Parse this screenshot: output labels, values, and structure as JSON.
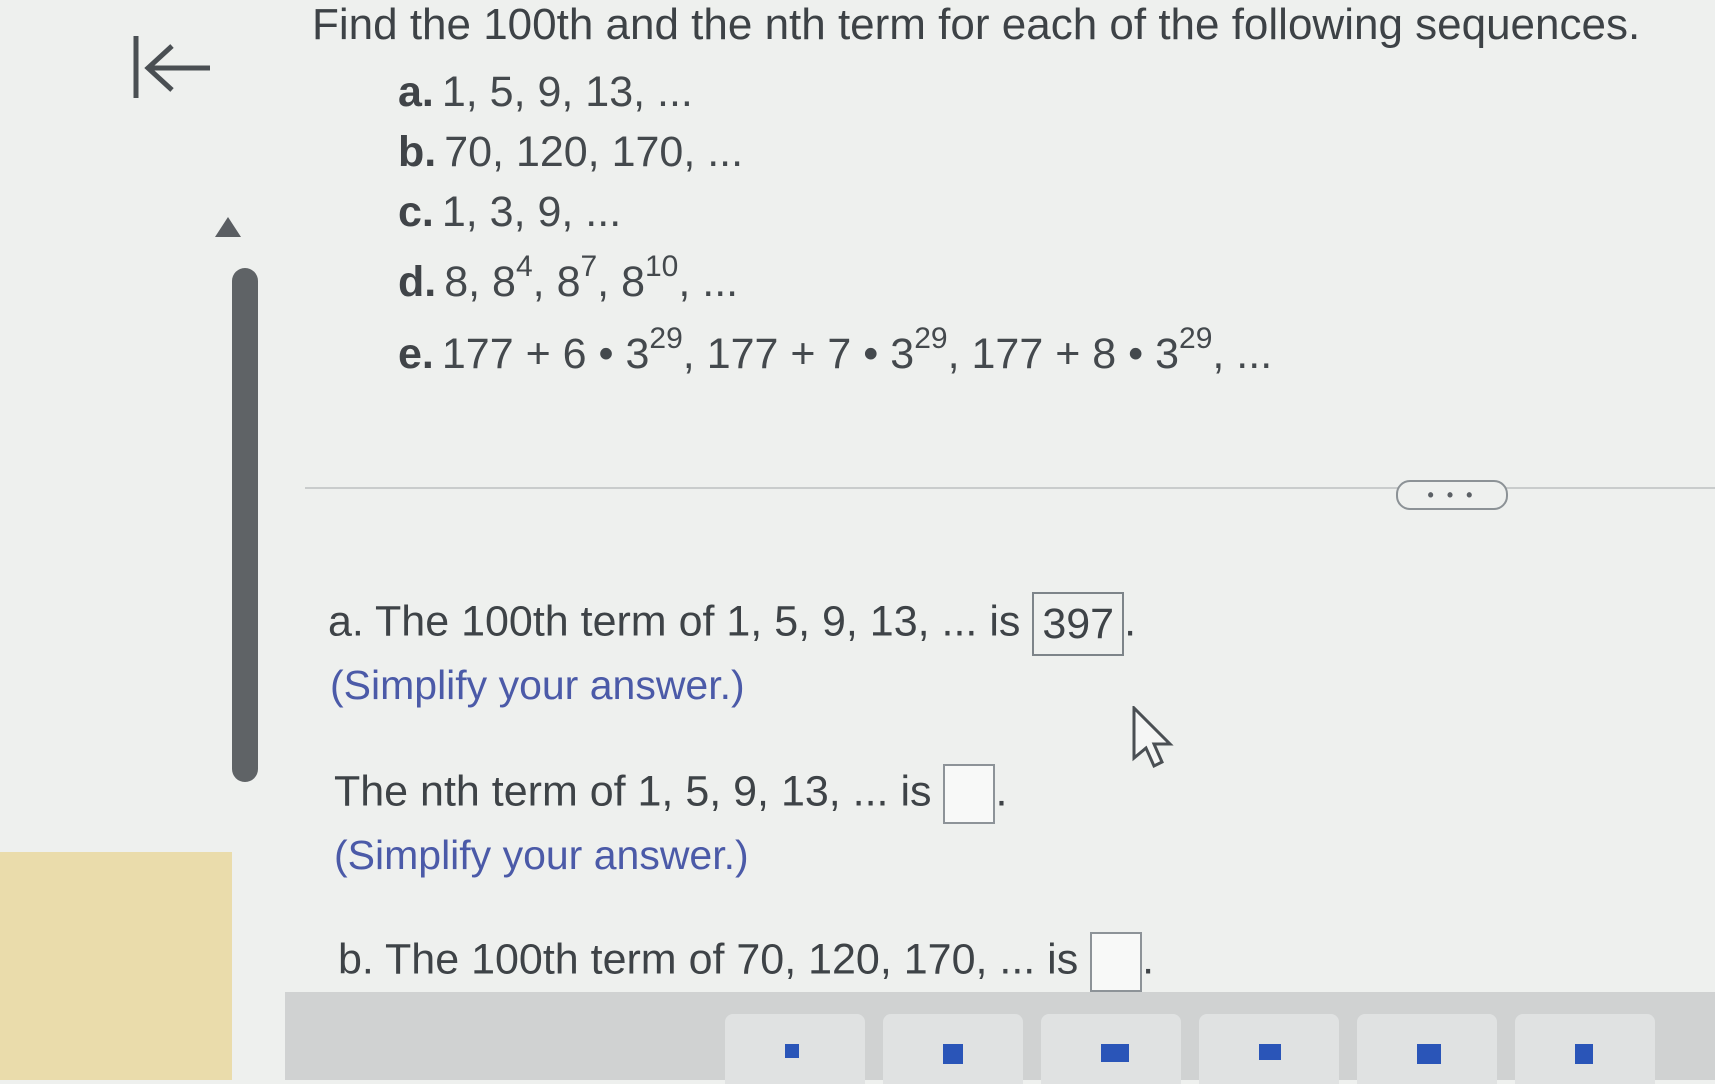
{
  "question": {
    "prompt": "Find the 100th and the nth term for each of the following sequences.",
    "items": [
      {
        "letter": "a.",
        "text": "1, 5, 9, 13, ..."
      },
      {
        "letter": "b.",
        "text": "70, 120, 170, ..."
      },
      {
        "letter": "c.",
        "text": "1, 3, 9, ..."
      },
      {
        "letter": "d.",
        "base": "8",
        "e1": "4",
        "e2": "7",
        "e3": "10",
        "tail": ", ..."
      },
      {
        "letter": "e.",
        "p1": "177 + 6 • 3",
        "p2": "177 + 7 • 3",
        "p3": "177 + 8 • 3",
        "exp": "29",
        "tail": ", ..."
      }
    ]
  },
  "more_button": "• • •",
  "answers": {
    "a_100th": {
      "prefix": "a. The 100th term of 1, 5, 9, 13, ... is",
      "value": "397",
      "suffix": ".",
      "hint": "(Simplify your answer.)"
    },
    "a_nth": {
      "prefix": "The nth term of 1, 5, 9, 13, ... is",
      "value": "",
      "suffix": ".",
      "hint": "(Simplify your answer.)"
    },
    "b_100th": {
      "prefix": "b. The 100th term of 70, 120, 170, ... is",
      "value": "",
      "suffix": "."
    }
  },
  "colors": {
    "hint": "#4b5aa8",
    "scrollbar": "#5f6366",
    "sticky_note": "#eadcab",
    "toolbar_icon": "#2a55b8"
  },
  "icons": {
    "back": "back-to-start-icon",
    "scroll_up": "triangle-up-icon",
    "cursor": "mouse-pointer-icon"
  }
}
